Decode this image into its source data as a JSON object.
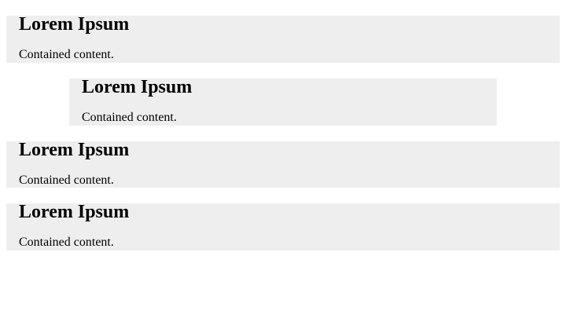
{
  "panels": [
    {
      "title": "Lorem Ipsum",
      "text": "Contained content."
    },
    {
      "title": "Lorem Ipsum",
      "text": "Contained content."
    },
    {
      "title": "Lorem Ipsum",
      "text": "Contained content."
    },
    {
      "title": "Lorem Ipsum",
      "text": "Contained content."
    }
  ],
  "colors": {
    "panel_background": "#eeeeee",
    "text": "#000000",
    "page_background": "#ffffff"
  }
}
